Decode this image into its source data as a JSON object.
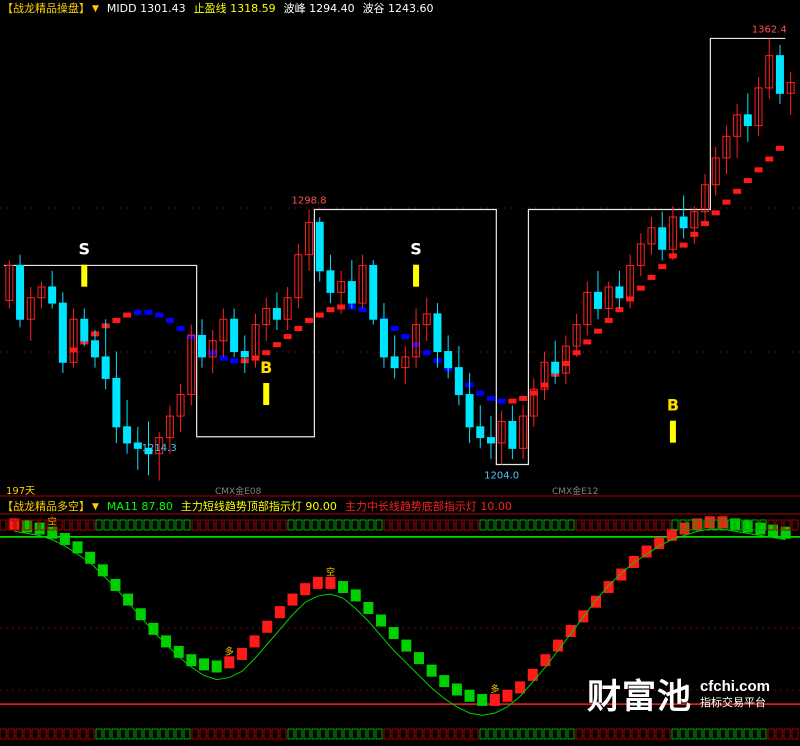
{
  "top_panel": {
    "indicator_name": "【战龙精品操盘】",
    "legend": [
      {
        "label": "MIDD",
        "value": "1301.43",
        "color": "#ffffff"
      },
      {
        "label": "止盈线",
        "value": "1318.59",
        "color": "#ffff00"
      },
      {
        "label": "波峰",
        "value": "1294.40",
        "color": "#ffffff"
      },
      {
        "label": "波谷",
        "value": "1243.60",
        "color": "#ffffff"
      }
    ],
    "bottom_left_label": "197天",
    "axis_marks": [
      "CMX金E08",
      "CMX金E12"
    ]
  },
  "bottom_panel": {
    "indicator_name": "【战龙精品多空】",
    "legend": [
      {
        "label": "MA11",
        "value": "87.80",
        "color": "#00ff00"
      },
      {
        "label": "主力短线趋势顶部指示灯",
        "value": "90.00",
        "color": "#ffff00"
      },
      {
        "label": "主力中长线趋势底部指示灯",
        "value": "10.00",
        "color": "#ff2020"
      }
    ]
  },
  "watermark": {
    "logo": "财富池",
    "domain": "cfchi.com",
    "subtitle": "指标交易平台"
  },
  "colors": {
    "up": "#ff2020",
    "down": "#00e5ff",
    "ribbon_up": "#ff1a1a",
    "ribbon_down": "#0000ff",
    "osc_up": "#ff1a1a",
    "osc_down": "#00d000",
    "signal": "#ffff00"
  },
  "chart_data": {
    "type": "candlestick",
    "price_range": [
      1196,
      1370
    ],
    "candles": [
      [
        1265,
        1280,
        1262,
        1278
      ],
      [
        1278,
        1282,
        1255,
        1258
      ],
      [
        1258,
        1270,
        1250,
        1266
      ],
      [
        1266,
        1272,
        1262,
        1270
      ],
      [
        1270,
        1276,
        1262,
        1264
      ],
      [
        1264,
        1268,
        1238,
        1242
      ],
      [
        1242,
        1262,
        1240,
        1258
      ],
      [
        1258,
        1262,
        1248,
        1250
      ],
      [
        1250,
        1254,
        1240,
        1244
      ],
      [
        1244,
        1258,
        1232,
        1236
      ],
      [
        1236,
        1246,
        1212,
        1218
      ],
      [
        1218,
        1228,
        1208,
        1212
      ],
      [
        1212,
        1218,
        1202,
        1210
      ],
      [
        1210,
        1220,
        1200,
        1208
      ],
      [
        1208,
        1216,
        1198,
        1214
      ],
      [
        1214,
        1226,
        1208,
        1222
      ],
      [
        1222,
        1234,
        1216,
        1230
      ],
      [
        1230,
        1256,
        1226,
        1252
      ],
      [
        1252,
        1258,
        1240,
        1244
      ],
      [
        1244,
        1254,
        1238,
        1250
      ],
      [
        1250,
        1262,
        1244,
        1258
      ],
      [
        1258,
        1262,
        1244,
        1246
      ],
      [
        1246,
        1252,
        1238,
        1244
      ],
      [
        1244,
        1260,
        1240,
        1256
      ],
      [
        1256,
        1266,
        1250,
        1262
      ],
      [
        1262,
        1268,
        1254,
        1258
      ],
      [
        1258,
        1270,
        1254,
        1266
      ],
      [
        1266,
        1286,
        1262,
        1282
      ],
      [
        1282,
        1298.8,
        1276,
        1294
      ],
      [
        1294,
        1296,
        1272,
        1276
      ],
      [
        1276,
        1282,
        1264,
        1268
      ],
      [
        1268,
        1276,
        1260,
        1272
      ],
      [
        1272,
        1280,
        1262,
        1264
      ],
      [
        1264,
        1282,
        1262,
        1278
      ],
      [
        1278,
        1280,
        1256,
        1258
      ],
      [
        1258,
        1264,
        1240,
        1244
      ],
      [
        1244,
        1252,
        1236,
        1240
      ],
      [
        1240,
        1248,
        1234,
        1244
      ],
      [
        1244,
        1262,
        1240,
        1256
      ],
      [
        1256,
        1266,
        1250,
        1260
      ],
      [
        1260,
        1264,
        1240,
        1246
      ],
      [
        1246,
        1252,
        1236,
        1240
      ],
      [
        1240,
        1248,
        1226,
        1230
      ],
      [
        1230,
        1238,
        1212,
        1218
      ],
      [
        1218,
        1226,
        1210,
        1214
      ],
      [
        1214,
        1222,
        1206,
        1212
      ],
      [
        1212,
        1224,
        1204.0,
        1220
      ],
      [
        1220,
        1226,
        1206,
        1210
      ],
      [
        1210,
        1226,
        1206,
        1222
      ],
      [
        1222,
        1236,
        1218,
        1232
      ],
      [
        1232,
        1246,
        1228,
        1242
      ],
      [
        1242,
        1250,
        1234,
        1238
      ],
      [
        1238,
        1252,
        1234,
        1248
      ],
      [
        1248,
        1260,
        1244,
        1256
      ],
      [
        1256,
        1272,
        1252,
        1268
      ],
      [
        1268,
        1276,
        1258,
        1262
      ],
      [
        1262,
        1272,
        1258,
        1270
      ],
      [
        1270,
        1276,
        1262,
        1266
      ],
      [
        1266,
        1282,
        1262,
        1278
      ],
      [
        1278,
        1290,
        1274,
        1286
      ],
      [
        1286,
        1296,
        1282,
        1292
      ],
      [
        1292,
        1298,
        1280,
        1284
      ],
      [
        1284,
        1300,
        1280,
        1296
      ],
      [
        1296,
        1304,
        1288,
        1292
      ],
      [
        1292,
        1300,
        1286,
        1298
      ],
      [
        1298,
        1312,
        1294,
        1308
      ],
      [
        1308,
        1322,
        1304,
        1318
      ],
      [
        1318,
        1330,
        1312,
        1326
      ],
      [
        1326,
        1338,
        1318,
        1334
      ],
      [
        1334,
        1342,
        1324,
        1330
      ],
      [
        1330,
        1348,
        1326,
        1344
      ],
      [
        1344,
        1362.4,
        1340,
        1356
      ],
      [
        1356,
        1360,
        1338,
        1342
      ],
      [
        1342,
        1350,
        1334,
        1346
      ]
    ],
    "wave_line": [
      {
        "from": 0,
        "to": 18,
        "value": 1278
      },
      {
        "from": 18,
        "to": 29,
        "value": 1214.3
      },
      {
        "from": 29,
        "to": 46,
        "value": 1298.8
      },
      {
        "from": 46,
        "to": 49,
        "value": 1204.0
      },
      {
        "from": 49,
        "to": 66,
        "value": 1298.8
      },
      {
        "from": 66,
        "to": 73,
        "value": 1362.4
      }
    ],
    "ribbon": [
      1246,
      1249,
      1252,
      1255,
      1257,
      1259,
      1260,
      1260,
      1259,
      1257,
      1254,
      1251,
      1248,
      1245,
      1243,
      1242,
      1242,
      1243,
      1245,
      1248,
      1251,
      1254,
      1257,
      1259,
      1261,
      1262,
      1262,
      1261,
      1259,
      1257,
      1254,
      1251,
      1248,
      1245,
      1242,
      1239,
      1236,
      1233,
      1230,
      1228,
      1227,
      1227,
      1228,
      1230,
      1233,
      1237,
      1241,
      1245,
      1249,
      1253,
      1257,
      1261,
      1265,
      1269,
      1273,
      1277,
      1281,
      1285,
      1289,
      1293,
      1297,
      1301,
      1305,
      1309,
      1313,
      1317,
      1321
    ],
    "ribbon_dir": [
      "u",
      "u",
      "u",
      "u",
      "u",
      "u",
      "d",
      "d",
      "d",
      "d",
      "d",
      "d",
      "d",
      "d",
      "d",
      "d",
      "u",
      "u",
      "u",
      "u",
      "u",
      "u",
      "u",
      "u",
      "u",
      "u",
      "d",
      "d",
      "d",
      "d",
      "d",
      "d",
      "d",
      "d",
      "d",
      "d",
      "d",
      "d",
      "d",
      "d",
      "d",
      "u",
      "u",
      "u",
      "u",
      "u",
      "u",
      "u",
      "u",
      "u",
      "u",
      "u",
      "u",
      "u",
      "u",
      "u",
      "u",
      "u",
      "u",
      "u",
      "u",
      "u",
      "u",
      "u",
      "u",
      "u",
      "u"
    ],
    "point_labels": [
      {
        "index": 28,
        "value": 1298.8,
        "text": "1298.8",
        "position": "above",
        "color": "#ff5050"
      },
      {
        "index": 14,
        "value": 1214.3,
        "text": "1214.3",
        "position": "below",
        "color": "#4fc3f7"
      },
      {
        "index": 46,
        "value": 1204.0,
        "text": "1204.0",
        "position": "below",
        "color": "#4fc3f7"
      },
      {
        "index": 71,
        "value": 1362.4,
        "text": "1362.4",
        "position": "above",
        "color": "#ff5050"
      }
    ],
    "signals": [
      {
        "index": 7,
        "text": "S",
        "color": "#ffffff",
        "value": 1282
      },
      {
        "index": 24,
        "text": "B",
        "color": "#ffdd00",
        "value": 1238
      },
      {
        "index": 38,
        "text": "S",
        "color": "#ffffff",
        "value": 1282
      },
      {
        "index": 62,
        "text": "B",
        "color": "#ffdd00",
        "value": 1224
      }
    ],
    "oscillator": {
      "range": [
        0,
        100
      ],
      "values": [
        96,
        95,
        94,
        92,
        89,
        85,
        80,
        74,
        67,
        60,
        53,
        46,
        40,
        35,
        31,
        29,
        28,
        30,
        34,
        40,
        47,
        54,
        60,
        65,
        68,
        68,
        66,
        62,
        56,
        50,
        44,
        38,
        32,
        26,
        21,
        17,
        14,
        12,
        12,
        14,
        18,
        24,
        31,
        38,
        45,
        52,
        59,
        66,
        72,
        78,
        83,
        87,
        91,
        94,
        96,
        97,
        97,
        96,
        95,
        94,
        93,
        92
      ],
      "labels": [
        {
          "index": 3,
          "text": "空"
        },
        {
          "index": 17,
          "text": "多"
        },
        {
          "index": 25,
          "text": "空"
        },
        {
          "index": 38,
          "text": "多"
        }
      ],
      "ma11_values": [
        97,
        96,
        95,
        93,
        90,
        86,
        82,
        76,
        70,
        63,
        56,
        49,
        43,
        37,
        32,
        28,
        26,
        27,
        30,
        36,
        43,
        50,
        57,
        63,
        66,
        67,
        65,
        60,
        54,
        47,
        40,
        34,
        28,
        22,
        17,
        13,
        10,
        9,
        10,
        13,
        18,
        25,
        32,
        40,
        48,
        56,
        64,
        71,
        77,
        82,
        86,
        90,
        93,
        95,
        97,
        98,
        98,
        97,
        96,
        95,
        94,
        93
      ]
    }
  }
}
